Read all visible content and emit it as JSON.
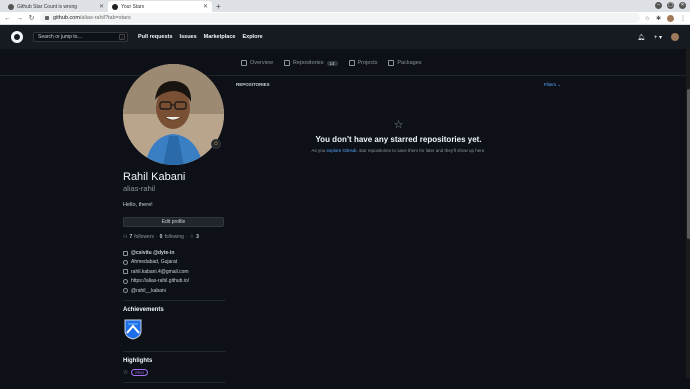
{
  "browser": {
    "tabs": [
      {
        "title": "Github Star Count is wrong"
      },
      {
        "title": "Your Stars"
      }
    ],
    "new_tab": "+",
    "url_host": "github.com",
    "url_path": "/alias-rahil?tab=stars"
  },
  "gh_header": {
    "search_placeholder": "Search or jump to…",
    "search_key": "/",
    "nav": [
      "Pull requests",
      "Issues",
      "Marketplace",
      "Explore"
    ]
  },
  "profile_tabs": [
    {
      "label": "Overview"
    },
    {
      "label": "Repositories",
      "count": "14"
    },
    {
      "label": "Projects"
    },
    {
      "label": "Packages"
    }
  ],
  "profile": {
    "name": "Rahil Kabani",
    "login": "alias-rahil",
    "bio": "Hello, there!",
    "edit_label": "Edit profile",
    "followers_count": "7",
    "followers_label": "followers",
    "following_count": "0",
    "following_label": "following",
    "stars_count": "3",
    "details": {
      "org": "@csivitu @dyte-in",
      "location": "Ahmedabad, Gujarat",
      "email": "rahil.kabani.4@gmail.com",
      "website": "https://alias-rahil.github.io/",
      "twitter": "@rahil__kabani"
    },
    "achievements_title": "Achievements",
    "highlights_title": "Highlights",
    "pro_label": "PRO"
  },
  "main": {
    "section_label": "REPOSITORIES",
    "filter_label": "Filters",
    "empty_title": "You don’t have any starred repositories yet.",
    "empty_prefix": "As you",
    "empty_link": "explore GitHub",
    "empty_suffix": ", star repositories to save them for later and they’ll show up here."
  }
}
